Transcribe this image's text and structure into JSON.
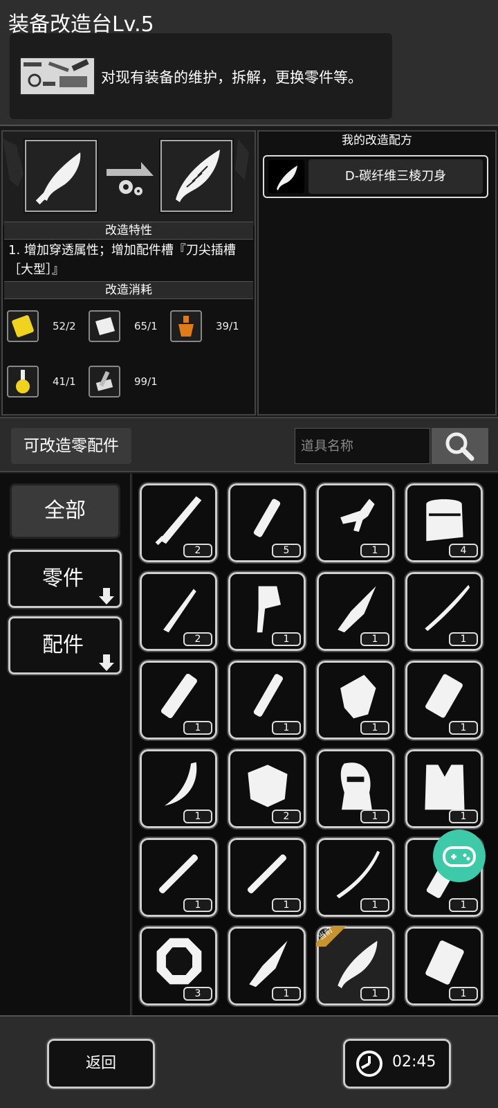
{
  "header": {
    "title": "装备改造台Lv.5",
    "description": "对现有装备的维护，拆解，更换零件等。",
    "icon": "workbench-tools-icon"
  },
  "upgrade": {
    "source_icon": "kukri-blade-icon",
    "target_icon": "feather-blade-icon",
    "traits_header": "改造特性",
    "traits_text": "1. 增加穿透属性；增加配件槽『刀尖插槽［大型］』",
    "cost_header": "改造消耗",
    "costs": [
      {
        "icon": "yellow-card-icon",
        "value": "52/2"
      },
      {
        "icon": "cloth-wrap-icon",
        "value": "65/1"
      },
      {
        "icon": "orange-potion-icon",
        "value": "39/1"
      },
      {
        "icon": "yellow-flask-icon",
        "value": "41/1"
      },
      {
        "icon": "metal-parts-icon",
        "value": "99/1"
      }
    ]
  },
  "recipes": {
    "title": "我的改造配方",
    "items": [
      {
        "name": "D-碳纤维三棱刀身",
        "icon": "feather-blade-icon"
      }
    ]
  },
  "parts": {
    "title": "可改造零配件",
    "search_placeholder": "道具名称"
  },
  "categories": [
    {
      "label": "全部",
      "selected": true
    },
    {
      "label": "零件",
      "expandable": true
    },
    {
      "label": "配件",
      "expandable": true
    }
  ],
  "grid_items": [
    {
      "icon": "long-blade-icon",
      "count": "2"
    },
    {
      "icon": "tube-handle-icon",
      "count": "5"
    },
    {
      "icon": "trigger-mechanism-icon",
      "count": "1"
    },
    {
      "icon": "backpack-icon",
      "count": "4"
    },
    {
      "icon": "dagger-blade-icon",
      "count": "2"
    },
    {
      "icon": "axe-head-icon",
      "count": "1"
    },
    {
      "icon": "spear-head-icon",
      "count": "1"
    },
    {
      "icon": "katana-blade-icon",
      "count": "1"
    },
    {
      "icon": "wrapped-grip-icon",
      "count": "1"
    },
    {
      "icon": "short-handle-icon",
      "count": "1"
    },
    {
      "icon": "broken-axe-icon",
      "count": "1"
    },
    {
      "icon": "spiked-grip-icon",
      "count": "1"
    },
    {
      "icon": "curved-blade-icon",
      "count": "1"
    },
    {
      "icon": "armor-plate-icon",
      "count": "2"
    },
    {
      "icon": "balaclava-icon",
      "count": "1"
    },
    {
      "icon": "vest-icon",
      "count": "1"
    },
    {
      "icon": "scope-rod-icon",
      "count": "1"
    },
    {
      "icon": "scope-rod-icon",
      "count": "1"
    },
    {
      "icon": "sabre-blade-icon",
      "count": "1"
    },
    {
      "icon": "bandage-grip-icon",
      "count": "1"
    },
    {
      "icon": "weight-plate-icon",
      "count": "3"
    },
    {
      "icon": "spear-head-icon",
      "count": "1"
    },
    {
      "icon": "kukri-blade-icon",
      "count": "1",
      "current": true,
      "tag": "当前"
    },
    {
      "icon": "pouch-icon",
      "count": "1"
    }
  ],
  "footer": {
    "back_label": "返回",
    "timer": "02:45",
    "timer_icon": "clock-icon"
  },
  "floating": {
    "icon": "gamepad-icon"
  },
  "colors": {
    "accent_green": "#3ec9a8",
    "current_tag": "#c8932e",
    "potion_orange": "#e07b1a",
    "card_yellow": "#f0d31f"
  }
}
